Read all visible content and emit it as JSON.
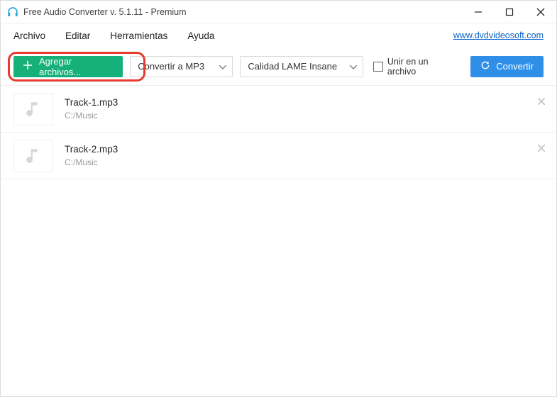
{
  "window": {
    "title": "Free Audio Converter v. 5.1.11 - Premium"
  },
  "menu": {
    "items": [
      "Archivo",
      "Editar",
      "Herramientas",
      "Ayuda"
    ],
    "brand_link": "www.dvdvideosoft.com"
  },
  "toolbar": {
    "add_label": "Agregar archivos...",
    "format_selected": "Convertir a MP3",
    "quality_selected": "Calidad LAME Insane",
    "join_checkbox_label": "Unir en un archivo",
    "join_checked": false,
    "convert_label": "Convertir"
  },
  "tracks": [
    {
      "name": "Track-1.mp3",
      "path": "C:/Music"
    },
    {
      "name": "Track-2.mp3",
      "path": "C:/Music"
    }
  ],
  "colors": {
    "green": "#16b07a",
    "blue": "#2f8fe8",
    "highlight": "#e63b2f"
  }
}
